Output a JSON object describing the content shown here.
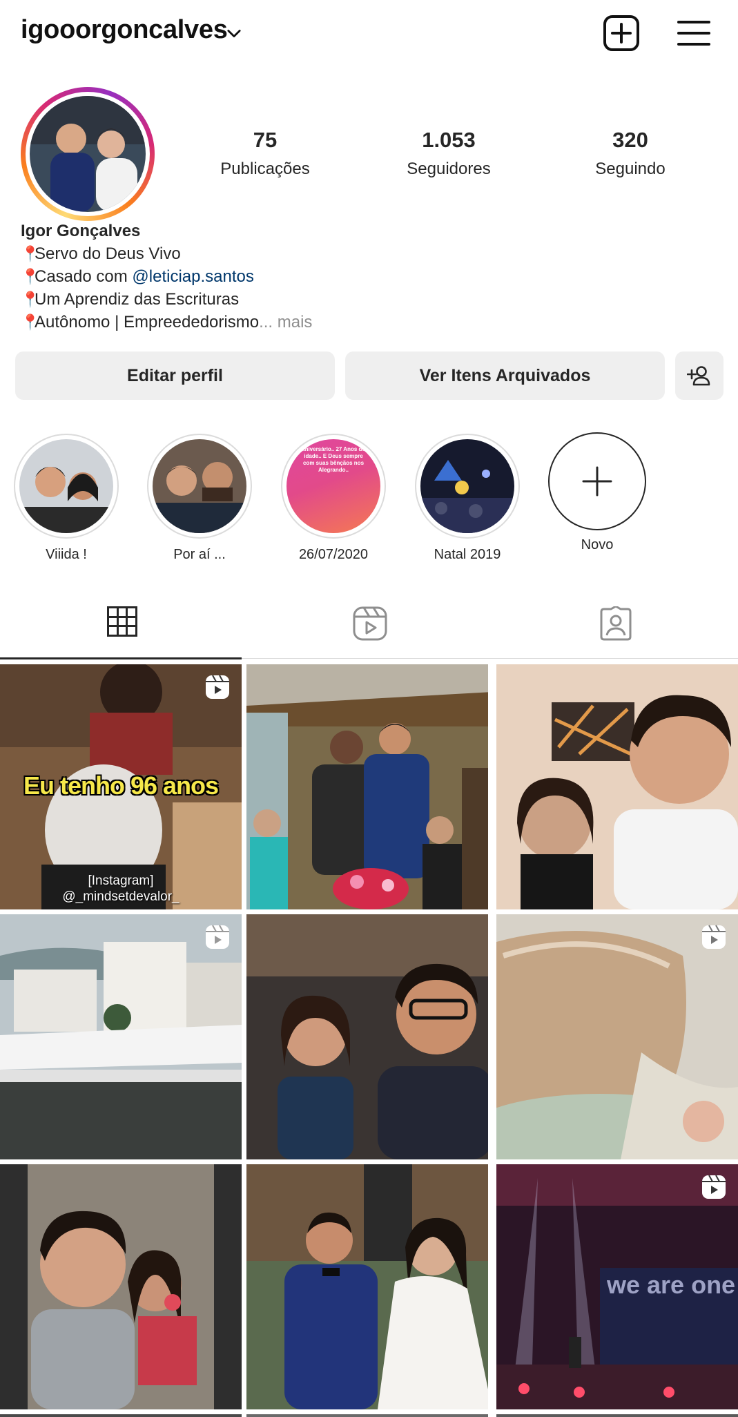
{
  "header": {
    "username": "igooorgoncalves",
    "icons": {
      "dropdown": "chevron-down-icon",
      "create": "plus-square-icon",
      "menu": "hamburger-menu-icon"
    }
  },
  "profile": {
    "stats": [
      {
        "value": "75",
        "label": "Publicações"
      },
      {
        "value": "1.053",
        "label": "Seguidores"
      },
      {
        "value": "320",
        "label": "Seguindo"
      }
    ],
    "name": "Igor Gonçalves",
    "bio": {
      "line1": "Servo do Deus Vivo",
      "line2_prefix": "Casado com ",
      "line2_mention": "@leticiap.santos",
      "line3": "Um Aprendiz das Escrituras",
      "line4": "Autônomo | Empreededorismo",
      "ellipsis": "...",
      "more": " mais"
    }
  },
  "actions": {
    "edit": "Editar perfil",
    "archived": "Ver Itens Arquivados",
    "discover_icon": "add-person-icon"
  },
  "highlights": [
    {
      "label": "Viiida !"
    },
    {
      "label": "Por aí ..."
    },
    {
      "label": "26/07/2020",
      "cover_text": "aniversário.. 27 Anos de idade.. E Deus sempre com suas bênçãos nos Alegrando.."
    },
    {
      "label": "Natal 2019"
    }
  ],
  "new_highlight": {
    "label": "Novo"
  },
  "tabs": [
    {
      "icon": "grid-icon",
      "active": true
    },
    {
      "icon": "reels-icon",
      "active": false
    },
    {
      "icon": "tagged-icon",
      "active": false
    }
  ],
  "posts": [
    {
      "type": "reel",
      "caption": "Eu tenho 96 anos",
      "watermark1": "[Instagram]",
      "watermark2": "@_mindsetdevalor_"
    },
    {
      "type": "photo"
    },
    {
      "type": "photo"
    },
    {
      "type": "reel"
    },
    {
      "type": "photo"
    },
    {
      "type": "reel"
    },
    {
      "type": "photo"
    },
    {
      "type": "photo"
    },
    {
      "type": "reel",
      "screen_text": "we are one"
    }
  ],
  "colors": {
    "mention": "#00376b",
    "button_bg": "#efefef",
    "text": "#262626",
    "muted": "#8e8e8e"
  }
}
